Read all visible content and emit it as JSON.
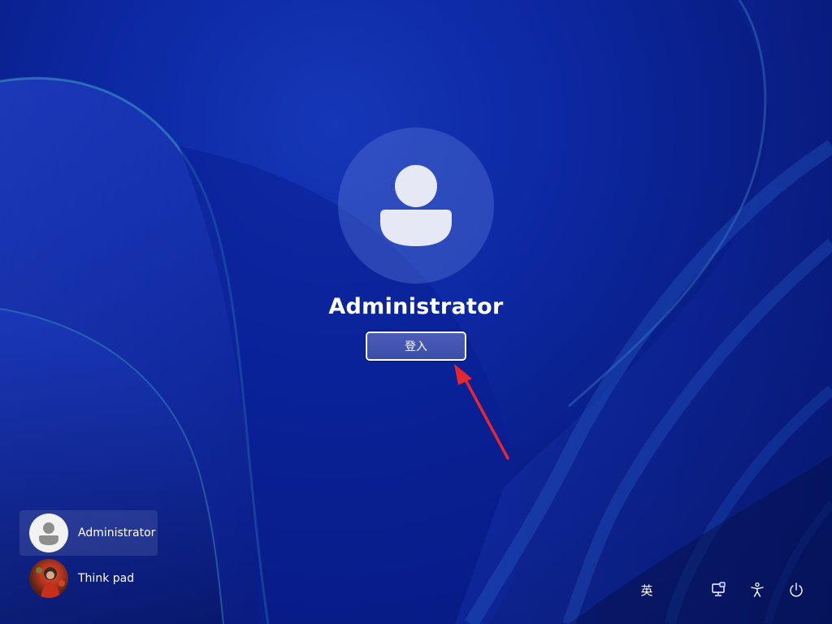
{
  "lock_screen": {
    "username": "Administrator",
    "signin_label": "登入"
  },
  "users": [
    {
      "name": "Administrator",
      "avatar": "default-user-avatar",
      "selected": true
    },
    {
      "name": "Think pad",
      "avatar": "photo-avatar",
      "selected": false
    }
  ],
  "tray": {
    "ime_label": "英",
    "network_icon": "network-icon",
    "accessibility_icon": "accessibility-icon",
    "power_icon": "power-icon"
  },
  "colors": {
    "background": "#0c27a0",
    "button": "#3b4ea8",
    "arrow": "#e8262f"
  }
}
